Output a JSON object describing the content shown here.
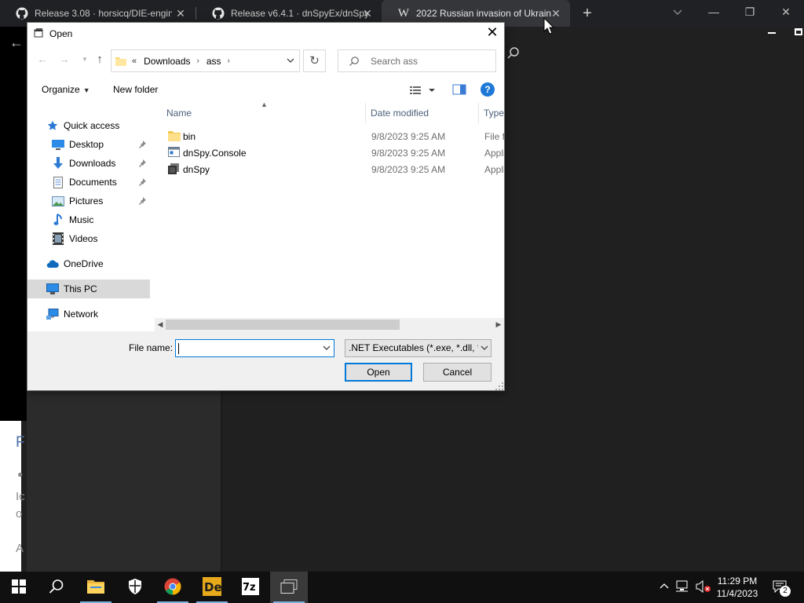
{
  "browser": {
    "tabs": [
      {
        "title": "Release 3.08 · horsicq/DIE-engine",
        "favicon": "github-icon",
        "active": false
      },
      {
        "title": "Release v6.4.1 · dnSpyEx/dnSpy",
        "favicon": "github-icon",
        "active": false
      },
      {
        "title": "2022 Russian invasion of Ukraine",
        "favicon": "wikipedia-icon",
        "active": true
      }
    ],
    "new_tab": "+",
    "background_fragments": [
      "F",
      "Ic",
      "o",
      "A"
    ]
  },
  "dialog": {
    "title": "Open",
    "address": {
      "overflow": "«",
      "crumbs": [
        "Downloads",
        "ass"
      ]
    },
    "search_placeholder": "Search ass",
    "toolbar": {
      "organize": "Organize",
      "new_folder": "New folder",
      "help": "?"
    },
    "nav": [
      {
        "label": "Quick access",
        "icon": "star-icon",
        "level": 0,
        "pinned": false
      },
      {
        "label": "Desktop",
        "icon": "desktop-icon",
        "level": 1,
        "pinned": true
      },
      {
        "label": "Downloads",
        "icon": "download-icon",
        "level": 1,
        "pinned": true
      },
      {
        "label": "Documents",
        "icon": "documents-icon",
        "level": 1,
        "pinned": true
      },
      {
        "label": "Pictures",
        "icon": "pictures-icon",
        "level": 1,
        "pinned": true
      },
      {
        "label": "Music",
        "icon": "music-icon",
        "level": 1,
        "pinned": false
      },
      {
        "label": "Videos",
        "icon": "videos-icon",
        "level": 1,
        "pinned": false
      },
      {
        "label": "OneDrive",
        "icon": "cloud-icon",
        "level": 0,
        "pinned": false
      },
      {
        "label": "This PC",
        "icon": "computer-icon",
        "level": 0,
        "pinned": false,
        "selected": true
      },
      {
        "label": "Network",
        "icon": "network-icon",
        "level": 0,
        "pinned": false
      }
    ],
    "columns": {
      "name": "Name",
      "date": "Date modified",
      "type": "Type"
    },
    "files": [
      {
        "name": "bin",
        "date": "9/8/2023 9:25 AM",
        "type": "File fo",
        "icon": "folder-icon"
      },
      {
        "name": "dnSpy.Console",
        "date": "9/8/2023 9:25 AM",
        "type": "Appli",
        "icon": "console-app-icon"
      },
      {
        "name": "dnSpy",
        "date": "9/8/2023 9:25 AM",
        "type": "Appli",
        "icon": "dnspy-app-icon"
      }
    ],
    "file_name_label": "File name:",
    "file_name_value": "",
    "filter": ".NET Executables (*.exe, *.dll, *.",
    "open_button": "Open",
    "cancel_button": "Cancel"
  },
  "taskbar": {
    "apps": [
      "start-icon",
      "search-icon",
      "file-explorer-icon",
      "security-icon",
      "chrome-icon",
      "detect-it-easy-icon",
      "7zip-icon",
      "task-view-icon"
    ],
    "time": "11:29 PM",
    "date": "11/4/2023",
    "notifications": "2"
  },
  "colors": {
    "accent": "#0078d7",
    "selected_nav": "#d9d9d9",
    "taskbar": "#101010",
    "tab_active": "#35363a"
  }
}
